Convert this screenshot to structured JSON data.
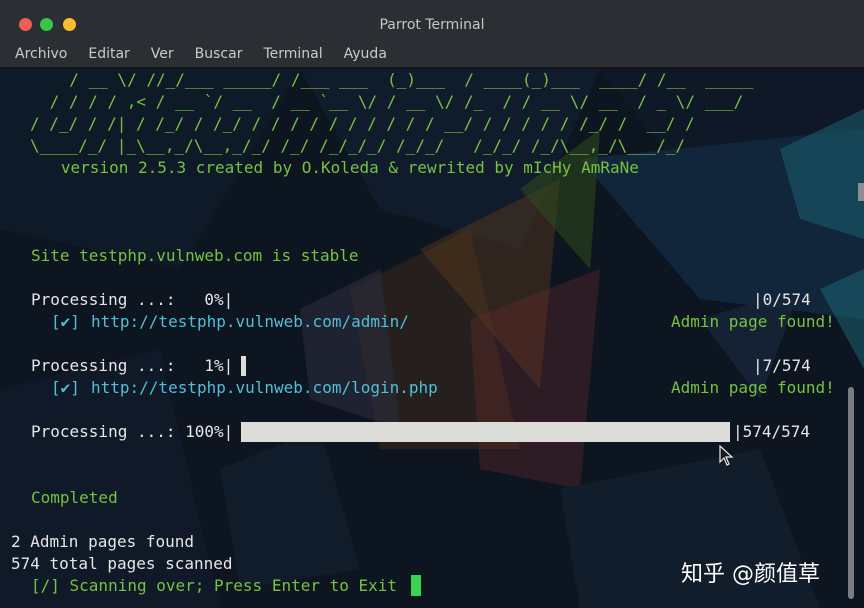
{
  "window": {
    "title": "Parrot Terminal"
  },
  "menu": [
    "Archivo",
    "Editar",
    "Ver",
    "Buscar",
    "Terminal",
    "Ayuda"
  ],
  "banner": {
    "lines": [
      "  / __ \\/ //_/___ _____/ /___ ___  (_)___  / ____(_)___  ____/ /__  _____",
      " / / / / ,< / __ `/ __  / __ `__ \\/ / __ \\/ /_  / / __ \\/ __  / _ \\/ ___/",
      "/ /_/ / /| / /_/ / /_/ / / / / / / / / / / __/ / / / / / /_/ /  __/ /",
      "\\____/_/ |_\\__,_/\\__,_/_/ /_/ /_/_/_/ /_/_/   /_/_/ /_/\\__,_/\\___/_/"
    ],
    "version": "   version 2.5.3 created by O.Koleda & rewrited by mIcHy AmRaNe"
  },
  "site_status": "Site testphp.vulnweb.com is stable",
  "progress": [
    {
      "label": "Processing ...:   0%|",
      "percent": 0,
      "count": "|0/574",
      "result": {
        "mark": "[✔]",
        "url": "http://testphp.vulnweb.com/admin/",
        "status": "Admin page found!"
      }
    },
    {
      "label": "Processing ...:   1%|",
      "percent": 1,
      "count": "|7/574",
      "result": {
        "mark": "[✔]",
        "url": "http://testphp.vulnweb.com/login.php",
        "status": "Admin page found!"
      }
    },
    {
      "label": "Processing ...: 100%|",
      "percent": 100,
      "count": "|574/574"
    }
  ],
  "completed": "Completed",
  "summary": {
    "admin_pages": "2 Admin pages found",
    "total_pages": "574 total pages scanned",
    "exit_prompt": "[/] Scanning over; Press Enter to Exit"
  },
  "watermark": "知乎 @颜值草",
  "colors": {
    "green": "#76c240",
    "cyan": "#4fc0d8",
    "cursor": "#39d353",
    "progress_fill": "#dcdcd8"
  }
}
